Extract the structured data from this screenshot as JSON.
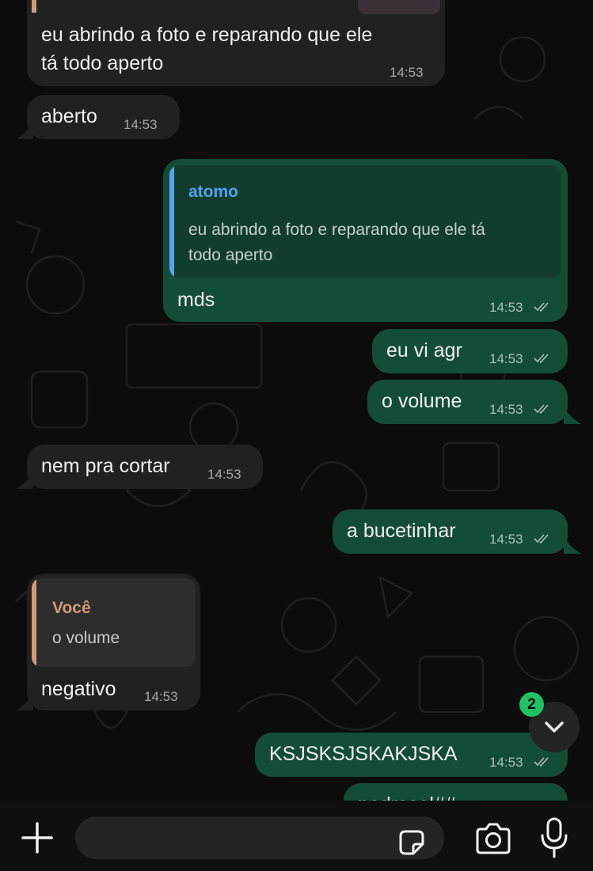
{
  "messages": [
    {
      "id": "m1",
      "direction": "incoming",
      "text_line1": "eu abrindo a foto e reparando que ele",
      "text_line2": "tá todo aperto",
      "time": "14:53",
      "has_image_preview": true
    },
    {
      "id": "m2",
      "direction": "incoming",
      "text": "aberto",
      "time": "14:53"
    },
    {
      "id": "m3",
      "direction": "outgoing",
      "reply_to": {
        "author": "atomo",
        "text_line1": "eu abrindo a foto e reparando que ele tá",
        "text_line2": "todo aperto"
      },
      "text": "mds",
      "time": "14:53",
      "status": "read"
    },
    {
      "id": "m4",
      "direction": "outgoing",
      "text": "eu vi agr",
      "time": "14:53",
      "status": "read"
    },
    {
      "id": "m5",
      "direction": "outgoing",
      "text": "o volume",
      "time": "14:53",
      "status": "read"
    },
    {
      "id": "m6",
      "direction": "incoming",
      "text": "nem pra cortar",
      "time": "14:53"
    },
    {
      "id": "m7",
      "direction": "outgoing",
      "text": "a bucetinhar",
      "time": "14:53",
      "status": "read"
    },
    {
      "id": "m8",
      "direction": "incoming",
      "reply_to": {
        "author": "Você",
        "text": "o volume"
      },
      "text": "negativo",
      "time": "14:53"
    },
    {
      "id": "m9",
      "direction": "outgoing",
      "text": "KSJSKSJSKAKJSKA",
      "time": "14:53",
      "status": "read"
    },
    {
      "id": "m10",
      "direction": "outgoing",
      "text": "padrasol##",
      "partially_visible": true
    }
  ],
  "scroll_to_bottom": {
    "unread_count": "2",
    "icon": "chevron-down-icon"
  },
  "composer": {
    "placeholder": "",
    "icons": [
      "plus-icon",
      "sticker-icon",
      "camera-icon",
      "microphone-icon"
    ]
  },
  "colors": {
    "incoming_bubble": "#212121",
    "outgoing_bubble": "#144d37",
    "quote_bar_outgoing": "#53a3f0",
    "quote_name_outgoing": "#53a3f0",
    "quote_bar_incoming": "#d39a7a",
    "quote_name_incoming": "#d39a7a",
    "unread_badge": "#21c063"
  }
}
